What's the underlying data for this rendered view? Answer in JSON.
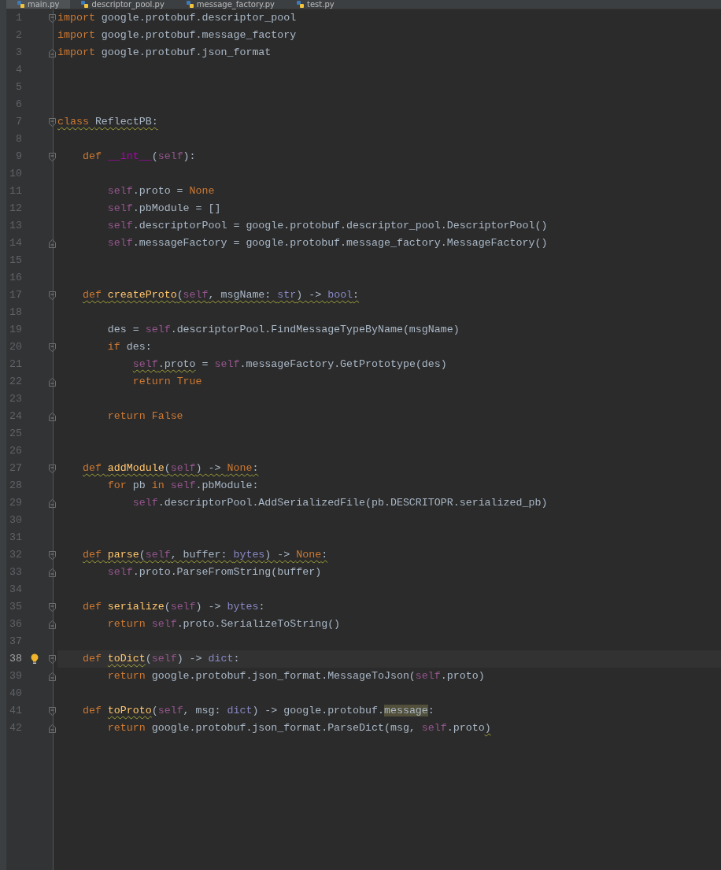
{
  "tabs": [
    {
      "label": "main.py",
      "selected": true
    },
    {
      "label": "descriptor_pool.py",
      "selected": false
    },
    {
      "label": "message_factory.py",
      "selected": false
    },
    {
      "label": "test.py",
      "selected": false
    }
  ],
  "lines": [
    {
      "number": "1",
      "fold_start": true,
      "fold_end": false,
      "current": false,
      "bulb": false,
      "tokens": [
        {
          "kind": "keyword",
          "text": "import"
        },
        {
          "kind": "plain",
          "text": " google.protobuf.descriptor_pool"
        }
      ]
    },
    {
      "number": "2",
      "fold_start": false,
      "fold_end": false,
      "current": false,
      "bulb": false,
      "tokens": [
        {
          "kind": "keyword",
          "text": "import"
        },
        {
          "kind": "plain",
          "text": " google.protobuf.message_factory"
        }
      ]
    },
    {
      "number": "3",
      "fold_start": false,
      "fold_end": true,
      "current": false,
      "bulb": false,
      "tokens": [
        {
          "kind": "keyword",
          "text": "import"
        },
        {
          "kind": "plain",
          "text": " google.protobuf.json_format"
        }
      ]
    },
    {
      "number": "4",
      "fold_start": false,
      "fold_end": false,
      "current": false,
      "bulb": false
    },
    {
      "number": "5",
      "fold_start": false,
      "fold_end": false,
      "current": false,
      "bulb": false
    },
    {
      "number": "6",
      "fold_start": false,
      "fold_end": false,
      "current": false,
      "bulb": false
    },
    {
      "number": "7",
      "fold_start": true,
      "fold_end": false,
      "current": false,
      "bulb": false,
      "tokens": [
        {
          "kind": "keyword",
          "text": "class ",
          "squiggle": true
        },
        {
          "kind": "plain",
          "text": "ReflectPB:",
          "squiggle": true
        }
      ]
    },
    {
      "number": "8",
      "fold_start": false,
      "fold_end": false,
      "current": false,
      "bulb": false
    },
    {
      "number": "9",
      "fold_start": true,
      "fold_end": false,
      "current": false,
      "bulb": false,
      "tokens": [
        {
          "kind": "keyword",
          "text": "    def "
        },
        {
          "kind": "magic",
          "text": "__int__"
        },
        {
          "kind": "plain",
          "text": "("
        },
        {
          "kind": "self",
          "text": "self"
        },
        {
          "kind": "plain",
          "text": "):"
        }
      ]
    },
    {
      "number": "10",
      "fold_start": false,
      "fold_end": false,
      "current": false,
      "bulb": false
    },
    {
      "number": "11",
      "fold_start": false,
      "fold_end": false,
      "current": false,
      "bulb": false,
      "tokens": [
        {
          "kind": "self",
          "text": "        self"
        },
        {
          "kind": "plain",
          "text": ".proto = "
        },
        {
          "kind": "constant",
          "text": "None"
        }
      ]
    },
    {
      "number": "12",
      "fold_start": false,
      "fold_end": false,
      "current": false,
      "bulb": false,
      "tokens": [
        {
          "kind": "self",
          "text": "        self"
        },
        {
          "kind": "plain",
          "text": ".pbModule = []"
        }
      ]
    },
    {
      "number": "13",
      "fold_start": false,
      "fold_end": false,
      "current": false,
      "bulb": false,
      "tokens": [
        {
          "kind": "self",
          "text": "        self"
        },
        {
          "kind": "plain",
          "text": ".descriptorPool = google.protobuf.descriptor_pool.DescriptorPool()"
        }
      ]
    },
    {
      "number": "14",
      "fold_start": false,
      "fold_end": true,
      "current": false,
      "bulb": false,
      "tokens": [
        {
          "kind": "self",
          "text": "        self"
        },
        {
          "kind": "plain",
          "text": ".messageFactory = google.protobuf.message_factory.MessageFactory()"
        }
      ]
    },
    {
      "number": "15",
      "fold_start": false,
      "fold_end": false,
      "current": false,
      "bulb": false
    },
    {
      "number": "16",
      "fold_start": false,
      "fold_end": false,
      "current": false,
      "bulb": false
    },
    {
      "number": "17",
      "fold_start": true,
      "fold_end": false,
      "current": false,
      "bulb": false,
      "tokens": [
        {
          "kind": "keyword",
          "text": "    def ",
          "squiggle": true
        },
        {
          "kind": "function",
          "text": "createProto",
          "squiggle": true
        },
        {
          "kind": "plain",
          "text": "(",
          "squiggle": true
        },
        {
          "kind": "self",
          "text": "self",
          "squiggle": true
        },
        {
          "kind": "plain",
          "text": ", msgName: ",
          "squiggle": true
        },
        {
          "kind": "type",
          "text": "str",
          "squiggle": true
        },
        {
          "kind": "plain",
          "text": ") -> ",
          "squiggle": true
        },
        {
          "kind": "type",
          "text": "bool",
          "squiggle": true
        },
        {
          "kind": "plain",
          "text": ":",
          "squiggle": true
        }
      ]
    },
    {
      "number": "18",
      "fold_start": false,
      "fold_end": false,
      "current": false,
      "bulb": false
    },
    {
      "number": "19",
      "fold_start": false,
      "fold_end": false,
      "current": false,
      "bulb": false,
      "tokens": [
        {
          "kind": "plain",
          "text": "        des = "
        },
        {
          "kind": "self",
          "text": "self"
        },
        {
          "kind": "plain",
          "text": ".descriptorPool.FindMessageTypeByName(msgName)"
        }
      ]
    },
    {
      "number": "20",
      "fold_start": true,
      "fold_end": false,
      "current": false,
      "bulb": false,
      "tokens": [
        {
          "kind": "keyword",
          "text": "        if "
        },
        {
          "kind": "plain",
          "text": "des:"
        }
      ]
    },
    {
      "number": "21",
      "fold_start": false,
      "fold_end": false,
      "current": false,
      "bulb": false,
      "tokens": [
        {
          "kind": "self",
          "text": "            self",
          "squiggle": true
        },
        {
          "kind": "plain",
          "text": ".proto",
          "squiggle": true
        },
        {
          "kind": "plain",
          "text": " = "
        },
        {
          "kind": "self",
          "text": "self"
        },
        {
          "kind": "plain",
          "text": ".messageFactory.GetPrototype(des)"
        }
      ]
    },
    {
      "number": "22",
      "fold_start": false,
      "fold_end": true,
      "current": false,
      "bulb": false,
      "tokens": [
        {
          "kind": "keyword",
          "text": "            return "
        },
        {
          "kind": "constant",
          "text": "True"
        }
      ]
    },
    {
      "number": "23",
      "fold_start": false,
      "fold_end": false,
      "current": false,
      "bulb": false
    },
    {
      "number": "24",
      "fold_start": false,
      "fold_end": true,
      "current": false,
      "bulb": false,
      "tokens": [
        {
          "kind": "keyword",
          "text": "        return "
        },
        {
          "kind": "constant",
          "text": "False"
        }
      ]
    },
    {
      "number": "25",
      "fold_start": false,
      "fold_end": false,
      "current": false,
      "bulb": false
    },
    {
      "number": "26",
      "fold_start": false,
      "fold_end": false,
      "current": false,
      "bulb": false
    },
    {
      "number": "27",
      "fold_start": true,
      "fold_end": false,
      "current": false,
      "bulb": false,
      "tokens": [
        {
          "kind": "keyword",
          "text": "    def ",
          "squiggle": true
        },
        {
          "kind": "function",
          "text": "addModule",
          "squiggle": true
        },
        {
          "kind": "plain",
          "text": "(",
          "squiggle": true
        },
        {
          "kind": "self",
          "text": "self",
          "squiggle": true
        },
        {
          "kind": "plain",
          "text": ") -> ",
          "squiggle": true
        },
        {
          "kind": "constant",
          "text": "None",
          "squiggle": true
        },
        {
          "kind": "plain",
          "text": ":",
          "squiggle": true
        }
      ]
    },
    {
      "number": "28",
      "fold_start": false,
      "fold_end": false,
      "current": false,
      "bulb": false,
      "tokens": [
        {
          "kind": "keyword",
          "text": "        for "
        },
        {
          "kind": "plain",
          "text": "pb "
        },
        {
          "kind": "keyword",
          "text": "in "
        },
        {
          "kind": "self",
          "text": "self"
        },
        {
          "kind": "plain",
          "text": ".pbModule:"
        }
      ]
    },
    {
      "number": "29",
      "fold_start": false,
      "fold_end": true,
      "current": false,
      "bulb": false,
      "tokens": [
        {
          "kind": "self",
          "text": "            self"
        },
        {
          "kind": "plain",
          "text": ".descriptorPool.AddSerializedFile(pb.DESCRITOPR.serialized_pb)"
        }
      ]
    },
    {
      "number": "30",
      "fold_start": false,
      "fold_end": false,
      "current": false,
      "bulb": false
    },
    {
      "number": "31",
      "fold_start": false,
      "fold_end": false,
      "current": false,
      "bulb": false
    },
    {
      "number": "32",
      "fold_start": true,
      "fold_end": false,
      "current": false,
      "bulb": false,
      "tokens": [
        {
          "kind": "keyword",
          "text": "    def ",
          "squiggle": true
        },
        {
          "kind": "function",
          "text": "parse",
          "squiggle": true
        },
        {
          "kind": "plain",
          "text": "(",
          "squiggle": true
        },
        {
          "kind": "self",
          "text": "self",
          "squiggle": true
        },
        {
          "kind": "plain",
          "text": ", buffer: ",
          "squiggle": true
        },
        {
          "kind": "type",
          "text": "bytes",
          "squiggle": true
        },
        {
          "kind": "plain",
          "text": ") -> ",
          "squiggle": true
        },
        {
          "kind": "constant",
          "text": "None",
          "squiggle": true
        },
        {
          "kind": "plain",
          "text": ":",
          "squiggle": true
        }
      ]
    },
    {
      "number": "33",
      "fold_start": false,
      "fold_end": true,
      "current": false,
      "bulb": false,
      "tokens": [
        {
          "kind": "self",
          "text": "        self"
        },
        {
          "kind": "plain",
          "text": ".proto.ParseFromString(buffer)"
        }
      ]
    },
    {
      "number": "34",
      "fold_start": false,
      "fold_end": false,
      "current": false,
      "bulb": false
    },
    {
      "number": "35",
      "fold_start": true,
      "fold_end": false,
      "current": false,
      "bulb": false,
      "tokens": [
        {
          "kind": "keyword",
          "text": "    def "
        },
        {
          "kind": "function",
          "text": "serialize"
        },
        {
          "kind": "plain",
          "text": "("
        },
        {
          "kind": "self",
          "text": "self"
        },
        {
          "kind": "plain",
          "text": ") -> "
        },
        {
          "kind": "type",
          "text": "bytes"
        },
        {
          "kind": "plain",
          "text": ":"
        }
      ]
    },
    {
      "number": "36",
      "fold_start": false,
      "fold_end": true,
      "current": false,
      "bulb": false,
      "tokens": [
        {
          "kind": "keyword",
          "text": "        return "
        },
        {
          "kind": "self",
          "text": "self"
        },
        {
          "kind": "plain",
          "text": ".proto.SerializeToString()"
        }
      ]
    },
    {
      "number": "37",
      "fold_start": false,
      "fold_end": false,
      "current": false,
      "bulb": false
    },
    {
      "number": "38",
      "fold_start": true,
      "fold_end": false,
      "current": true,
      "bulb": true,
      "tokens": [
        {
          "kind": "keyword",
          "text": "    def "
        },
        {
          "kind": "function",
          "text": "toDict",
          "squiggle": true
        },
        {
          "kind": "plain",
          "text": "("
        },
        {
          "kind": "self",
          "text": "self"
        },
        {
          "kind": "plain",
          "text": ") -> "
        },
        {
          "kind": "type",
          "text": "dict"
        },
        {
          "kind": "plain",
          "text": ":"
        }
      ]
    },
    {
      "number": "39",
      "fold_start": false,
      "fold_end": true,
      "current": false,
      "bulb": false,
      "tokens": [
        {
          "kind": "keyword",
          "text": "        return "
        },
        {
          "kind": "plain",
          "text": "google.protobuf.json_format.MessageToJson("
        },
        {
          "kind": "self",
          "text": "self"
        },
        {
          "kind": "plain",
          "text": ".proto)"
        }
      ]
    },
    {
      "number": "40",
      "fold_start": false,
      "fold_end": false,
      "current": false,
      "bulb": false
    },
    {
      "number": "41",
      "fold_start": true,
      "fold_end": false,
      "current": false,
      "bulb": false,
      "tokens": [
        {
          "kind": "keyword",
          "text": "    def "
        },
        {
          "kind": "function",
          "text": "toProto",
          "squiggle": true
        },
        {
          "kind": "plain",
          "text": "("
        },
        {
          "kind": "self",
          "text": "self"
        },
        {
          "kind": "plain",
          "text": ", msg: "
        },
        {
          "kind": "type",
          "text": "dict"
        },
        {
          "kind": "plain",
          "text": ") -> google.protobuf."
        },
        {
          "kind": "plain",
          "text": "message",
          "highlight": true
        },
        {
          "kind": "plain",
          "text": ":"
        }
      ]
    },
    {
      "number": "42",
      "fold_start": false,
      "fold_end": true,
      "current": false,
      "bulb": false,
      "tokens": [
        {
          "kind": "keyword",
          "text": "        return "
        },
        {
          "kind": "plain",
          "text": "google.protobuf.json_format.ParseDict(msg, "
        },
        {
          "kind": "self",
          "text": "self"
        },
        {
          "kind": "plain",
          "text": ".proto"
        },
        {
          "kind": "plain",
          "text": ")",
          "squiggle": true
        }
      ]
    }
  ]
}
